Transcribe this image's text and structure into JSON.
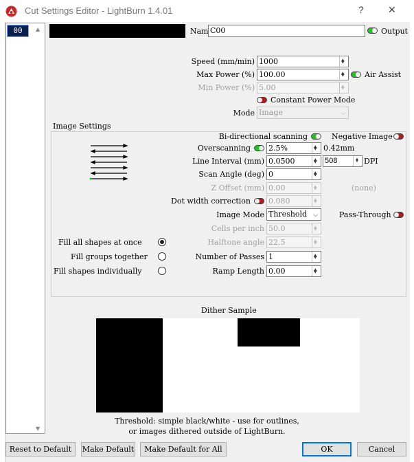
{
  "window": {
    "title": "Cut Settings Editor - LightBurn 1.4.01",
    "help_glyph": "?",
    "close_glyph": "✕"
  },
  "layers": {
    "items": [
      "00"
    ]
  },
  "header": {
    "name_label": "Name",
    "name_value": "C00",
    "output_label": "Output",
    "output_on": true
  },
  "power": {
    "speed_label": "Speed (mm/min)",
    "speed_value": "1000",
    "max_power_label": "Max Power (%)",
    "max_power_value": "100.00",
    "air_assist_label": "Air Assist",
    "air_assist_on": true,
    "min_power_label": "Min Power (%)",
    "min_power_value": "5.00",
    "constant_power_label": "Constant Power Mode",
    "constant_power_on": false,
    "mode_label": "Mode",
    "mode_value": "Image"
  },
  "image_settings": {
    "title": "Image Settings",
    "bidir_label": "Bi-directional scanning",
    "bidir_on": true,
    "negative_label": "Negative Image",
    "negative_on": false,
    "overscan_label": "Overscanning",
    "overscan_on": true,
    "overscan_value": "2.5%",
    "overscan_mm": "0.42mm",
    "line_interval_label": "Line Interval (mm)",
    "line_interval_value": "0.0500",
    "dpi_value": "508",
    "dpi_label": "DPI",
    "scan_angle_label": "Scan Angle (deg)",
    "scan_angle_value": "0",
    "z_offset_label": "Z Offset (mm)",
    "z_offset_value": "0.00",
    "z_offset_none": "(none)",
    "dot_width_label": "Dot width correction",
    "dot_width_on": false,
    "dot_width_value": "0.080",
    "image_mode_label": "Image Mode",
    "image_mode_value": "Threshold",
    "pass_through_label": "Pass-Through",
    "pass_through_on": false,
    "cells_label": "Cells per inch",
    "cells_value": "50.0",
    "halftone_label": "Halftone angle",
    "halftone_value": "22.5",
    "passes_label": "Number of Passes",
    "passes_value": "1",
    "ramp_label": "Ramp Length",
    "ramp_value": "0.00",
    "fill_all_label": "Fill all shapes at once",
    "fill_groups_label": "Fill groups together",
    "fill_individually_label": "Fill shapes individually",
    "fill_selected": "all"
  },
  "dither": {
    "title": "Dither Sample",
    "caption_line1": "Threshold: simple black/white - use for outlines,",
    "caption_line2": "or images dithered outside of LightBurn."
  },
  "footer": {
    "reset_label": "Reset to Default",
    "make_default_label": "Make Default",
    "make_default_all_label": "Make Default for All",
    "ok_label": "OK",
    "cancel_label": "Cancel"
  },
  "colors": {
    "toggle_on": "#21c321",
    "toggle_off": "#b11a1a",
    "selection": "#0b1f4e",
    "ok_border": "#0078d7"
  }
}
